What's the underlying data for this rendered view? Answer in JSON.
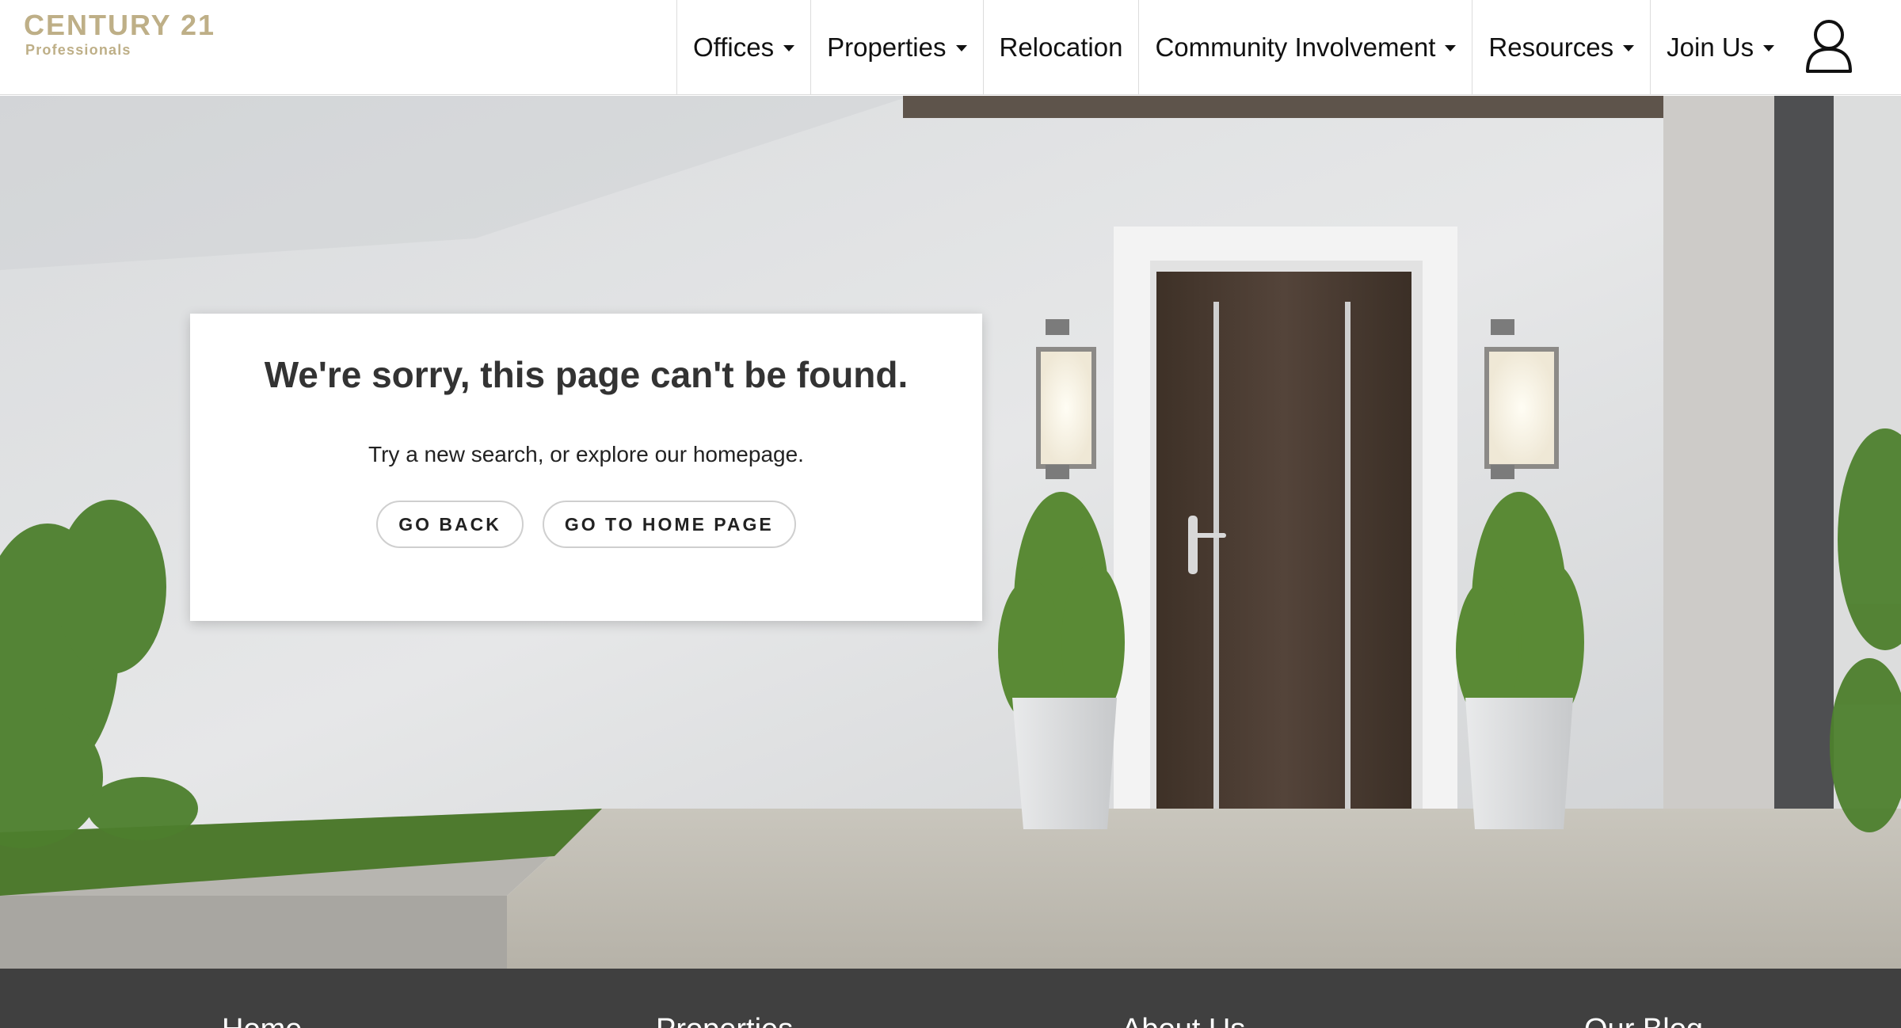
{
  "brand": {
    "name": "CENTURY 21",
    "subtitle": "Professionals",
    "color": "#beaf87"
  },
  "nav": {
    "items": [
      {
        "label": "Offices",
        "has_dropdown": true
      },
      {
        "label": "Properties",
        "has_dropdown": true
      },
      {
        "label": "Relocation",
        "has_dropdown": false
      },
      {
        "label": "Community Involvement",
        "has_dropdown": true
      },
      {
        "label": "Resources",
        "has_dropdown": true
      },
      {
        "label": "Join Us",
        "has_dropdown": true
      }
    ],
    "account_icon": "user-icon"
  },
  "error_card": {
    "title": "We're sorry, this page can't be found.",
    "message": "Try a new search, or explore our homepage.",
    "back_button": "GO BACK",
    "home_button": "GO TO HOME PAGE"
  },
  "hero": {
    "description_icon": "house-entrance-image"
  },
  "footer": {
    "background": "#404040",
    "links": [
      "Home",
      "Properties",
      "About Us",
      "Our Blog"
    ]
  }
}
